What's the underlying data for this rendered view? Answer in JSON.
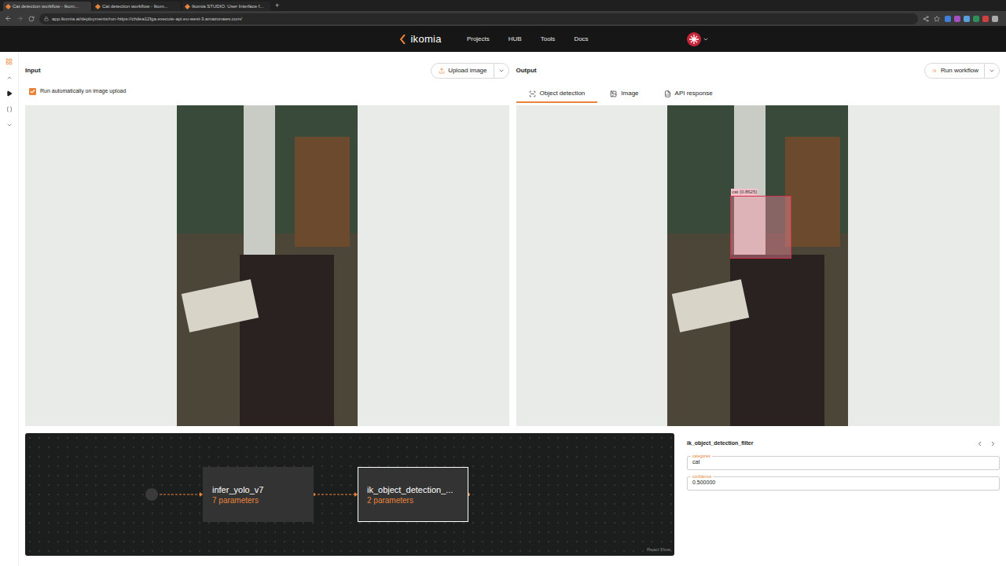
{
  "browser": {
    "tabs": [
      {
        "title": "Cat detection workflow - Ikom...",
        "selected": true
      },
      {
        "title": "Cat detection workflow - Ikom...",
        "selected": false
      },
      {
        "title": "Ikomia STUDIO: User Interface f...",
        "selected": false
      }
    ],
    "new_tab": "+",
    "url": "app.ikomia.ai/deployments/run-https://chdea12fga.execute-api.eu-west-3.amazonaws.com/"
  },
  "nav": {
    "logo": "ikomia",
    "items": [
      "Projects",
      "HUB",
      "Tools",
      "Docs"
    ]
  },
  "input": {
    "title": "Input",
    "upload_button": "Upload image",
    "auto_run": {
      "label": "Run automatically on image upload",
      "checked": true
    }
  },
  "output": {
    "title": "Output",
    "run_button": "Run workflow",
    "tabs": [
      {
        "label": "Object detection",
        "selected": true
      },
      {
        "label": "Image",
        "selected": false
      },
      {
        "label": "API response",
        "selected": false
      }
    ],
    "detections": [
      {
        "label": "cat (0.8625)"
      }
    ]
  },
  "workflow": {
    "nodes": [
      {
        "name": "infer_yolo_v7",
        "params": "7 parameters",
        "selected": false
      },
      {
        "name": "ik_object_detection_...",
        "params": "2 parameters",
        "selected": true
      }
    ],
    "attribution": "React Flow"
  },
  "params_panel": {
    "title": "ik_object_detection_filter",
    "fields": [
      {
        "label": "categories",
        "value": "cat"
      },
      {
        "label": "confidence",
        "value": "0.500000"
      }
    ]
  }
}
